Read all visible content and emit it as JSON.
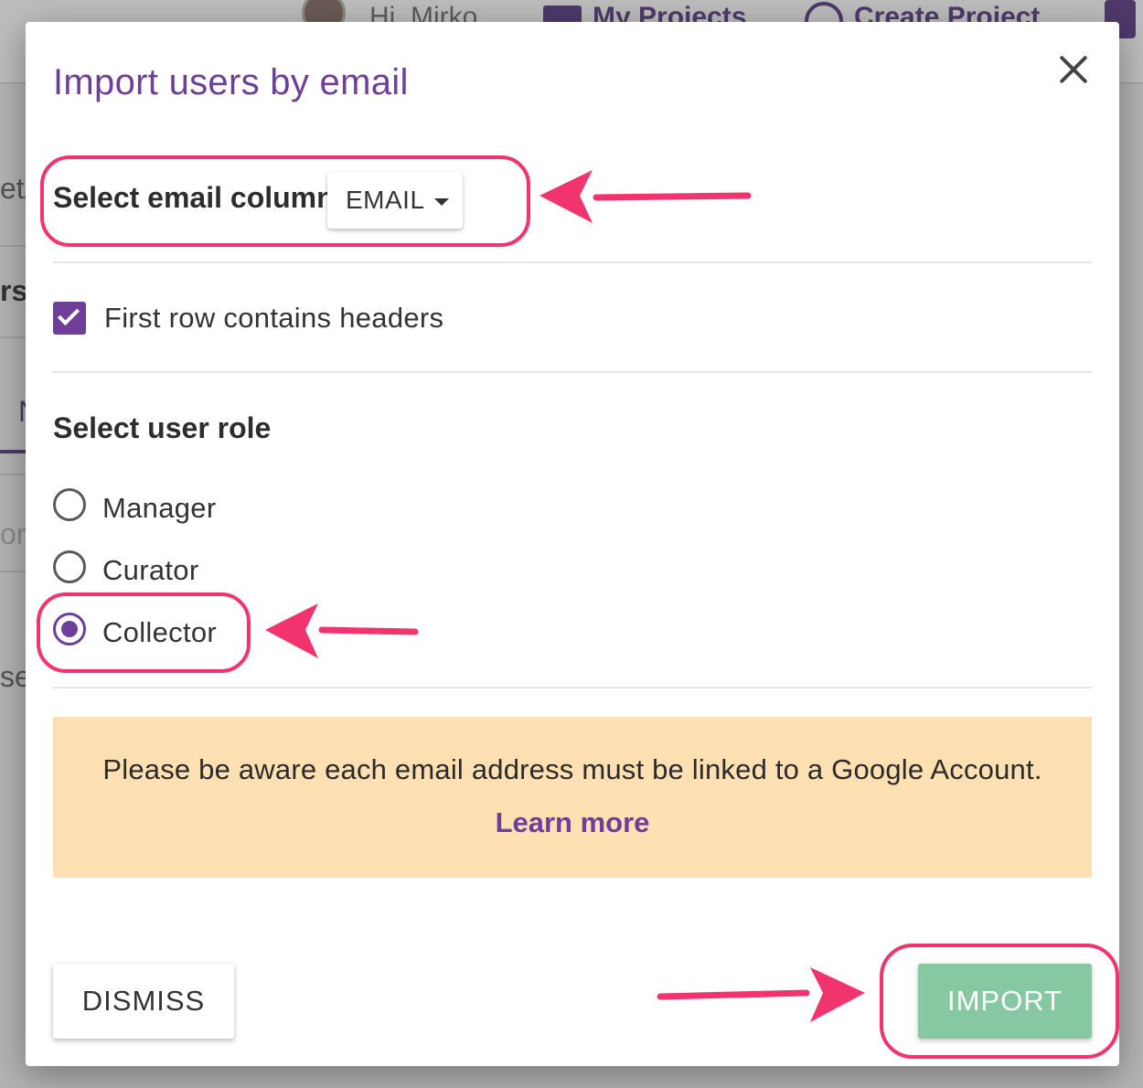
{
  "background": {
    "greeting": "Hi, Mirko",
    "my_projects": "My Projects",
    "create_project": "Create Project",
    "fragments": [
      "et/",
      "rs",
      "N",
      "or",
      "ser"
    ]
  },
  "dialog": {
    "title": "Import users by email",
    "email_column": {
      "label": "Select email column",
      "selected": "EMAIL"
    },
    "headers_checkbox": {
      "label": "First row contains headers",
      "checked": true
    },
    "role": {
      "label": "Select user role",
      "options": [
        "Manager",
        "Curator",
        "Collector"
      ],
      "selected": "Collector"
    },
    "notice": {
      "text": "Please be aware each email address must be linked to a Google Account.",
      "link": "Learn more"
    },
    "buttons": {
      "dismiss": "DISMISS",
      "import": "IMPORT"
    }
  },
  "colors": {
    "accent": "#6d3f98",
    "annotation": "#f2346e",
    "notice_bg": "#ffe0b3",
    "import_bg": "#86c8a2"
  }
}
